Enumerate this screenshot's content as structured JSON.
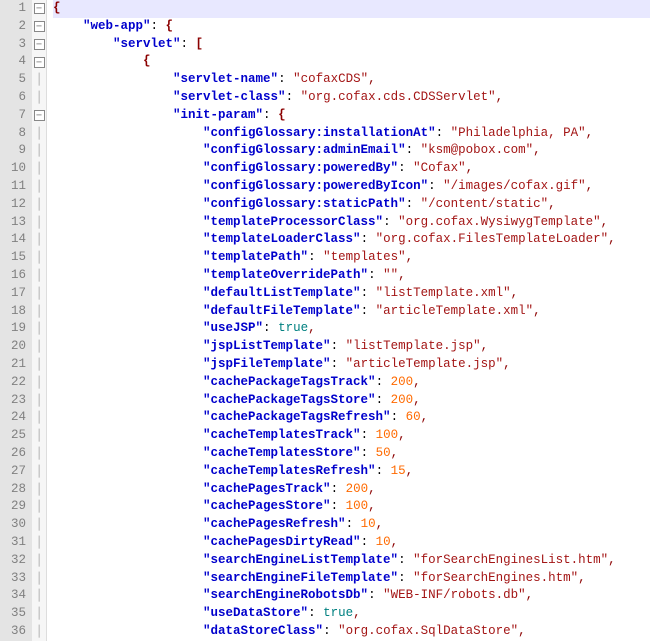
{
  "editor": {
    "current_line": 1,
    "lines": [
      {
        "n": 1,
        "fold": "minus",
        "indent": 0,
        "tokens": [
          {
            "t": "brace",
            "v": "{"
          }
        ]
      },
      {
        "n": 2,
        "fold": "minus",
        "indent": 1,
        "tokens": [
          {
            "t": "key",
            "v": "\"web-app\""
          },
          {
            "t": "colon",
            "v": ": "
          },
          {
            "t": "brace",
            "v": "{"
          }
        ]
      },
      {
        "n": 3,
        "fold": "minus",
        "indent": 2,
        "tokens": [
          {
            "t": "key",
            "v": "\"servlet\""
          },
          {
            "t": "colon",
            "v": ": "
          },
          {
            "t": "brace",
            "v": "["
          }
        ]
      },
      {
        "n": 4,
        "fold": "minus",
        "indent": 3,
        "tokens": [
          {
            "t": "brace",
            "v": "{"
          }
        ]
      },
      {
        "n": 5,
        "fold": "bar",
        "indent": 4,
        "tokens": [
          {
            "t": "key",
            "v": "\"servlet-name\""
          },
          {
            "t": "colon",
            "v": ": "
          },
          {
            "t": "str",
            "v": "\"cofaxCDS\""
          },
          {
            "t": "punc",
            "v": ","
          }
        ]
      },
      {
        "n": 6,
        "fold": "bar",
        "indent": 4,
        "tokens": [
          {
            "t": "key",
            "v": "\"servlet-class\""
          },
          {
            "t": "colon",
            "v": ": "
          },
          {
            "t": "str",
            "v": "\"org.cofax.cds.CDSServlet\""
          },
          {
            "t": "punc",
            "v": ","
          }
        ]
      },
      {
        "n": 7,
        "fold": "minus",
        "indent": 4,
        "tokens": [
          {
            "t": "key",
            "v": "\"init-param\""
          },
          {
            "t": "colon",
            "v": ": "
          },
          {
            "t": "brace",
            "v": "{"
          }
        ]
      },
      {
        "n": 8,
        "fold": "bar",
        "indent": 5,
        "tokens": [
          {
            "t": "key",
            "v": "\"configGlossary:installationAt\""
          },
          {
            "t": "colon",
            "v": ": "
          },
          {
            "t": "str",
            "v": "\"Philadelphia, PA\""
          },
          {
            "t": "punc",
            "v": ","
          }
        ]
      },
      {
        "n": 9,
        "fold": "bar",
        "indent": 5,
        "tokens": [
          {
            "t": "key",
            "v": "\"configGlossary:adminEmail\""
          },
          {
            "t": "colon",
            "v": ": "
          },
          {
            "t": "str",
            "v": "\"ksm@pobox.com\""
          },
          {
            "t": "punc",
            "v": ","
          }
        ]
      },
      {
        "n": 10,
        "fold": "bar",
        "indent": 5,
        "tokens": [
          {
            "t": "key",
            "v": "\"configGlossary:poweredBy\""
          },
          {
            "t": "colon",
            "v": ": "
          },
          {
            "t": "str",
            "v": "\"Cofax\""
          },
          {
            "t": "punc",
            "v": ","
          }
        ]
      },
      {
        "n": 11,
        "fold": "bar",
        "indent": 5,
        "tokens": [
          {
            "t": "key",
            "v": "\"configGlossary:poweredByIcon\""
          },
          {
            "t": "colon",
            "v": ": "
          },
          {
            "t": "str",
            "v": "\"/images/cofax.gif\""
          },
          {
            "t": "punc",
            "v": ","
          }
        ]
      },
      {
        "n": 12,
        "fold": "bar",
        "indent": 5,
        "tokens": [
          {
            "t": "key",
            "v": "\"configGlossary:staticPath\""
          },
          {
            "t": "colon",
            "v": ": "
          },
          {
            "t": "str",
            "v": "\"/content/static\""
          },
          {
            "t": "punc",
            "v": ","
          }
        ]
      },
      {
        "n": 13,
        "fold": "bar",
        "indent": 5,
        "tokens": [
          {
            "t": "key",
            "v": "\"templateProcessorClass\""
          },
          {
            "t": "colon",
            "v": ": "
          },
          {
            "t": "str",
            "v": "\"org.cofax.WysiwygTemplate\""
          },
          {
            "t": "punc",
            "v": ","
          }
        ]
      },
      {
        "n": 14,
        "fold": "bar",
        "indent": 5,
        "tokens": [
          {
            "t": "key",
            "v": "\"templateLoaderClass\""
          },
          {
            "t": "colon",
            "v": ": "
          },
          {
            "t": "str",
            "v": "\"org.cofax.FilesTemplateLoader\""
          },
          {
            "t": "punc",
            "v": ","
          }
        ]
      },
      {
        "n": 15,
        "fold": "bar",
        "indent": 5,
        "tokens": [
          {
            "t": "key",
            "v": "\"templatePath\""
          },
          {
            "t": "colon",
            "v": ": "
          },
          {
            "t": "str",
            "v": "\"templates\""
          },
          {
            "t": "punc",
            "v": ","
          }
        ]
      },
      {
        "n": 16,
        "fold": "bar",
        "indent": 5,
        "tokens": [
          {
            "t": "key",
            "v": "\"templateOverridePath\""
          },
          {
            "t": "colon",
            "v": ": "
          },
          {
            "t": "str",
            "v": "\"\""
          },
          {
            "t": "punc",
            "v": ","
          }
        ]
      },
      {
        "n": 17,
        "fold": "bar",
        "indent": 5,
        "tokens": [
          {
            "t": "key",
            "v": "\"defaultListTemplate\""
          },
          {
            "t": "colon",
            "v": ": "
          },
          {
            "t": "str",
            "v": "\"listTemplate.xml\""
          },
          {
            "t": "punc",
            "v": ","
          }
        ]
      },
      {
        "n": 18,
        "fold": "bar",
        "indent": 5,
        "tokens": [
          {
            "t": "key",
            "v": "\"defaultFileTemplate\""
          },
          {
            "t": "colon",
            "v": ": "
          },
          {
            "t": "str",
            "v": "\"articleTemplate.xml\""
          },
          {
            "t": "punc",
            "v": ","
          }
        ]
      },
      {
        "n": 19,
        "fold": "bar",
        "indent": 5,
        "tokens": [
          {
            "t": "key",
            "v": "\"useJSP\""
          },
          {
            "t": "colon",
            "v": ": "
          },
          {
            "t": "bool",
            "v": "true"
          },
          {
            "t": "punc",
            "v": ","
          }
        ]
      },
      {
        "n": 20,
        "fold": "bar",
        "indent": 5,
        "tokens": [
          {
            "t": "key",
            "v": "\"jspListTemplate\""
          },
          {
            "t": "colon",
            "v": ": "
          },
          {
            "t": "str",
            "v": "\"listTemplate.jsp\""
          },
          {
            "t": "punc",
            "v": ","
          }
        ]
      },
      {
        "n": 21,
        "fold": "bar",
        "indent": 5,
        "tokens": [
          {
            "t": "key",
            "v": "\"jspFileTemplate\""
          },
          {
            "t": "colon",
            "v": ": "
          },
          {
            "t": "str",
            "v": "\"articleTemplate.jsp\""
          },
          {
            "t": "punc",
            "v": ","
          }
        ]
      },
      {
        "n": 22,
        "fold": "bar",
        "indent": 5,
        "tokens": [
          {
            "t": "key",
            "v": "\"cachePackageTagsTrack\""
          },
          {
            "t": "colon",
            "v": ": "
          },
          {
            "t": "num",
            "v": "200"
          },
          {
            "t": "punc",
            "v": ","
          }
        ]
      },
      {
        "n": 23,
        "fold": "bar",
        "indent": 5,
        "tokens": [
          {
            "t": "key",
            "v": "\"cachePackageTagsStore\""
          },
          {
            "t": "colon",
            "v": ": "
          },
          {
            "t": "num",
            "v": "200"
          },
          {
            "t": "punc",
            "v": ","
          }
        ]
      },
      {
        "n": 24,
        "fold": "bar",
        "indent": 5,
        "tokens": [
          {
            "t": "key",
            "v": "\"cachePackageTagsRefresh\""
          },
          {
            "t": "colon",
            "v": ": "
          },
          {
            "t": "num",
            "v": "60"
          },
          {
            "t": "punc",
            "v": ","
          }
        ]
      },
      {
        "n": 25,
        "fold": "bar",
        "indent": 5,
        "tokens": [
          {
            "t": "key",
            "v": "\"cacheTemplatesTrack\""
          },
          {
            "t": "colon",
            "v": ": "
          },
          {
            "t": "num",
            "v": "100"
          },
          {
            "t": "punc",
            "v": ","
          }
        ]
      },
      {
        "n": 26,
        "fold": "bar",
        "indent": 5,
        "tokens": [
          {
            "t": "key",
            "v": "\"cacheTemplatesStore\""
          },
          {
            "t": "colon",
            "v": ": "
          },
          {
            "t": "num",
            "v": "50"
          },
          {
            "t": "punc",
            "v": ","
          }
        ]
      },
      {
        "n": 27,
        "fold": "bar",
        "indent": 5,
        "tokens": [
          {
            "t": "key",
            "v": "\"cacheTemplatesRefresh\""
          },
          {
            "t": "colon",
            "v": ": "
          },
          {
            "t": "num",
            "v": "15"
          },
          {
            "t": "punc",
            "v": ","
          }
        ]
      },
      {
        "n": 28,
        "fold": "bar",
        "indent": 5,
        "tokens": [
          {
            "t": "key",
            "v": "\"cachePagesTrack\""
          },
          {
            "t": "colon",
            "v": ": "
          },
          {
            "t": "num",
            "v": "200"
          },
          {
            "t": "punc",
            "v": ","
          }
        ]
      },
      {
        "n": 29,
        "fold": "bar",
        "indent": 5,
        "tokens": [
          {
            "t": "key",
            "v": "\"cachePagesStore\""
          },
          {
            "t": "colon",
            "v": ": "
          },
          {
            "t": "num",
            "v": "100"
          },
          {
            "t": "punc",
            "v": ","
          }
        ]
      },
      {
        "n": 30,
        "fold": "bar",
        "indent": 5,
        "tokens": [
          {
            "t": "key",
            "v": "\"cachePagesRefresh\""
          },
          {
            "t": "colon",
            "v": ": "
          },
          {
            "t": "num",
            "v": "10"
          },
          {
            "t": "punc",
            "v": ","
          }
        ]
      },
      {
        "n": 31,
        "fold": "bar",
        "indent": 5,
        "tokens": [
          {
            "t": "key",
            "v": "\"cachePagesDirtyRead\""
          },
          {
            "t": "colon",
            "v": ": "
          },
          {
            "t": "num",
            "v": "10"
          },
          {
            "t": "punc",
            "v": ","
          }
        ]
      },
      {
        "n": 32,
        "fold": "bar",
        "indent": 5,
        "tokens": [
          {
            "t": "key",
            "v": "\"searchEngineListTemplate\""
          },
          {
            "t": "colon",
            "v": ": "
          },
          {
            "t": "str",
            "v": "\"forSearchEnginesList.htm\""
          },
          {
            "t": "punc",
            "v": ","
          }
        ]
      },
      {
        "n": 33,
        "fold": "bar",
        "indent": 5,
        "tokens": [
          {
            "t": "key",
            "v": "\"searchEngineFileTemplate\""
          },
          {
            "t": "colon",
            "v": ": "
          },
          {
            "t": "str",
            "v": "\"forSearchEngines.htm\""
          },
          {
            "t": "punc",
            "v": ","
          }
        ]
      },
      {
        "n": 34,
        "fold": "bar",
        "indent": 5,
        "tokens": [
          {
            "t": "key",
            "v": "\"searchEngineRobotsDb\""
          },
          {
            "t": "colon",
            "v": ": "
          },
          {
            "t": "str",
            "v": "\"WEB-INF/robots.db\""
          },
          {
            "t": "punc",
            "v": ","
          }
        ]
      },
      {
        "n": 35,
        "fold": "bar",
        "indent": 5,
        "tokens": [
          {
            "t": "key",
            "v": "\"useDataStore\""
          },
          {
            "t": "colon",
            "v": ": "
          },
          {
            "t": "bool",
            "v": "true"
          },
          {
            "t": "punc",
            "v": ","
          }
        ]
      },
      {
        "n": 36,
        "fold": "bar",
        "indent": 5,
        "tokens": [
          {
            "t": "key",
            "v": "\"dataStoreClass\""
          },
          {
            "t": "colon",
            "v": ": "
          },
          {
            "t": "str",
            "v": "\"org.cofax.SqlDataStore\""
          },
          {
            "t": "punc",
            "v": ","
          }
        ]
      }
    ]
  }
}
